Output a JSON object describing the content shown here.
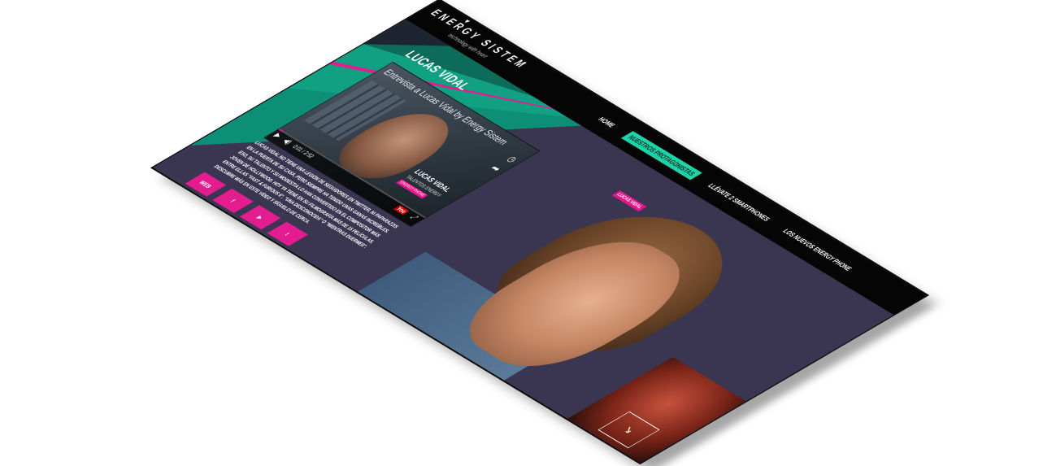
{
  "brand": {
    "name": "ENERGY SISTEM",
    "tagline": "technology with heart",
    "heart_icon": "heart-icon"
  },
  "nav": {
    "items": [
      {
        "label": "HOME",
        "active": false
      },
      {
        "label": "NUESTROS PROTAGONISTAS",
        "active": true
      },
      {
        "label": "LLÉVATE 2 SMARTPHONES",
        "active": false
      },
      {
        "label": "LOS NUEVOS ENERGY PHONE",
        "active": false
      }
    ]
  },
  "content": {
    "title": "LUCAS VIDAL",
    "video": {
      "title": "Entrevista a Lucas Vidal by Energy Sistem",
      "overlay_name": "LUCAS VIDAL",
      "overlay_sub": "TALENTOS ENERGY",
      "overlay_tag": "ENERGY PHONE",
      "time": "0:01 / 2:52",
      "progress": 0.03,
      "youtube_label": "You",
      "icons": {
        "play": "play-icon",
        "volume": "volume-icon",
        "fullscreen": "fullscreen-icon",
        "share": "share-icon",
        "clock": "clock-icon"
      }
    },
    "body": "LUCAS VIDAL NO TIENE UNA LEGIÓN DE SEGUIDORES EN TWITTER, NI PAPARAZZIS EN LA PUERTA DE SU CASA, PERO SIEMPRE HA TENIDO UNAS GANAS INCREÍBLES. ESO, SU TALENTO Y SU MODESTIA LO HAN CONVERTIDO EN EL COMPOSITOR MÁS JOVEN DE HOLLYWOOD. HOY YA TIENE EN SU FILMOGRAFÍA MÁS DE 15 PELÍCULAS, ENTRE ELLAS \"FAST & FURIOUS 6\", \"UNA DESCONOCIDA\" O \"MIENTRAS DUERMES\". DESCUBRE MÁS EN ESTE VÍDEO Y SÍGUELO DE CERCA.",
    "social": [
      {
        "label": "WEB",
        "icon": "web-icon"
      },
      {
        "label": "f",
        "icon": "facebook-icon"
      },
      {
        "label": "▶",
        "icon": "youtube-icon"
      },
      {
        "label": "t",
        "icon": "twitter-icon"
      }
    ]
  },
  "hero": {
    "badge": "LUCAS VIDAL",
    "next_icon": "arrow-down-right-icon",
    "next_label": "↘"
  },
  "colors": {
    "accent_pink": "#e31d8f",
    "accent_green": "#1fd3a8",
    "accent_teal": "#0d8f77",
    "accent_yellow": "#e4e619",
    "page_bg": "#3a3651",
    "topbar": "#050505"
  }
}
